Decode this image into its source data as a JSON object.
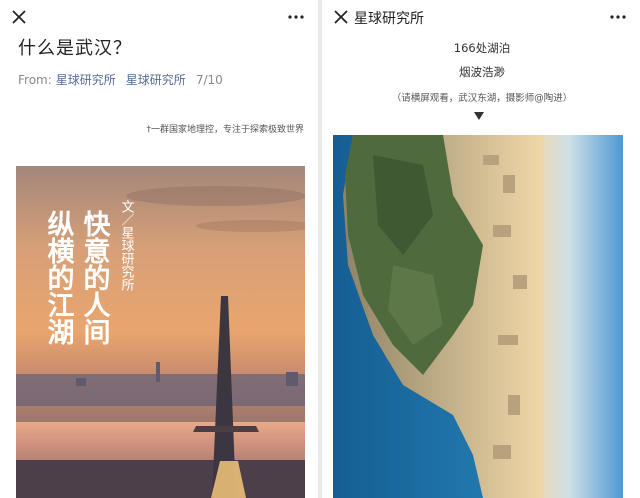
{
  "left_panel": {
    "article_title": "什么是武汉？",
    "meta": {
      "from_label": "From:",
      "account": "星球研究所",
      "author": "星球研究所",
      "page": "7/10"
    },
    "slogan": "†一群国家地理控，专注于探索极致世界",
    "cover": {
      "headline_col1": "快意的人间",
      "headline_col2": "纵横的江湖",
      "byline": "文／星球研究所"
    }
  },
  "right_panel": {
    "bar_title": "星球研究所",
    "caption_line1": "166处湖泊",
    "caption_line2": "烟波浩渺",
    "photo_note": "（请横屏观看，武汉东湖，摄影师@陶进）"
  },
  "icons": {
    "close": "close-icon",
    "more": "more-icon",
    "arrow": "triangle-down-icon"
  },
  "colors": {
    "account_link": "#576b95",
    "meta_gray": "#8a8a8a",
    "lake_blue": "#1f78b4",
    "sunset_orange": "#e8945a"
  }
}
